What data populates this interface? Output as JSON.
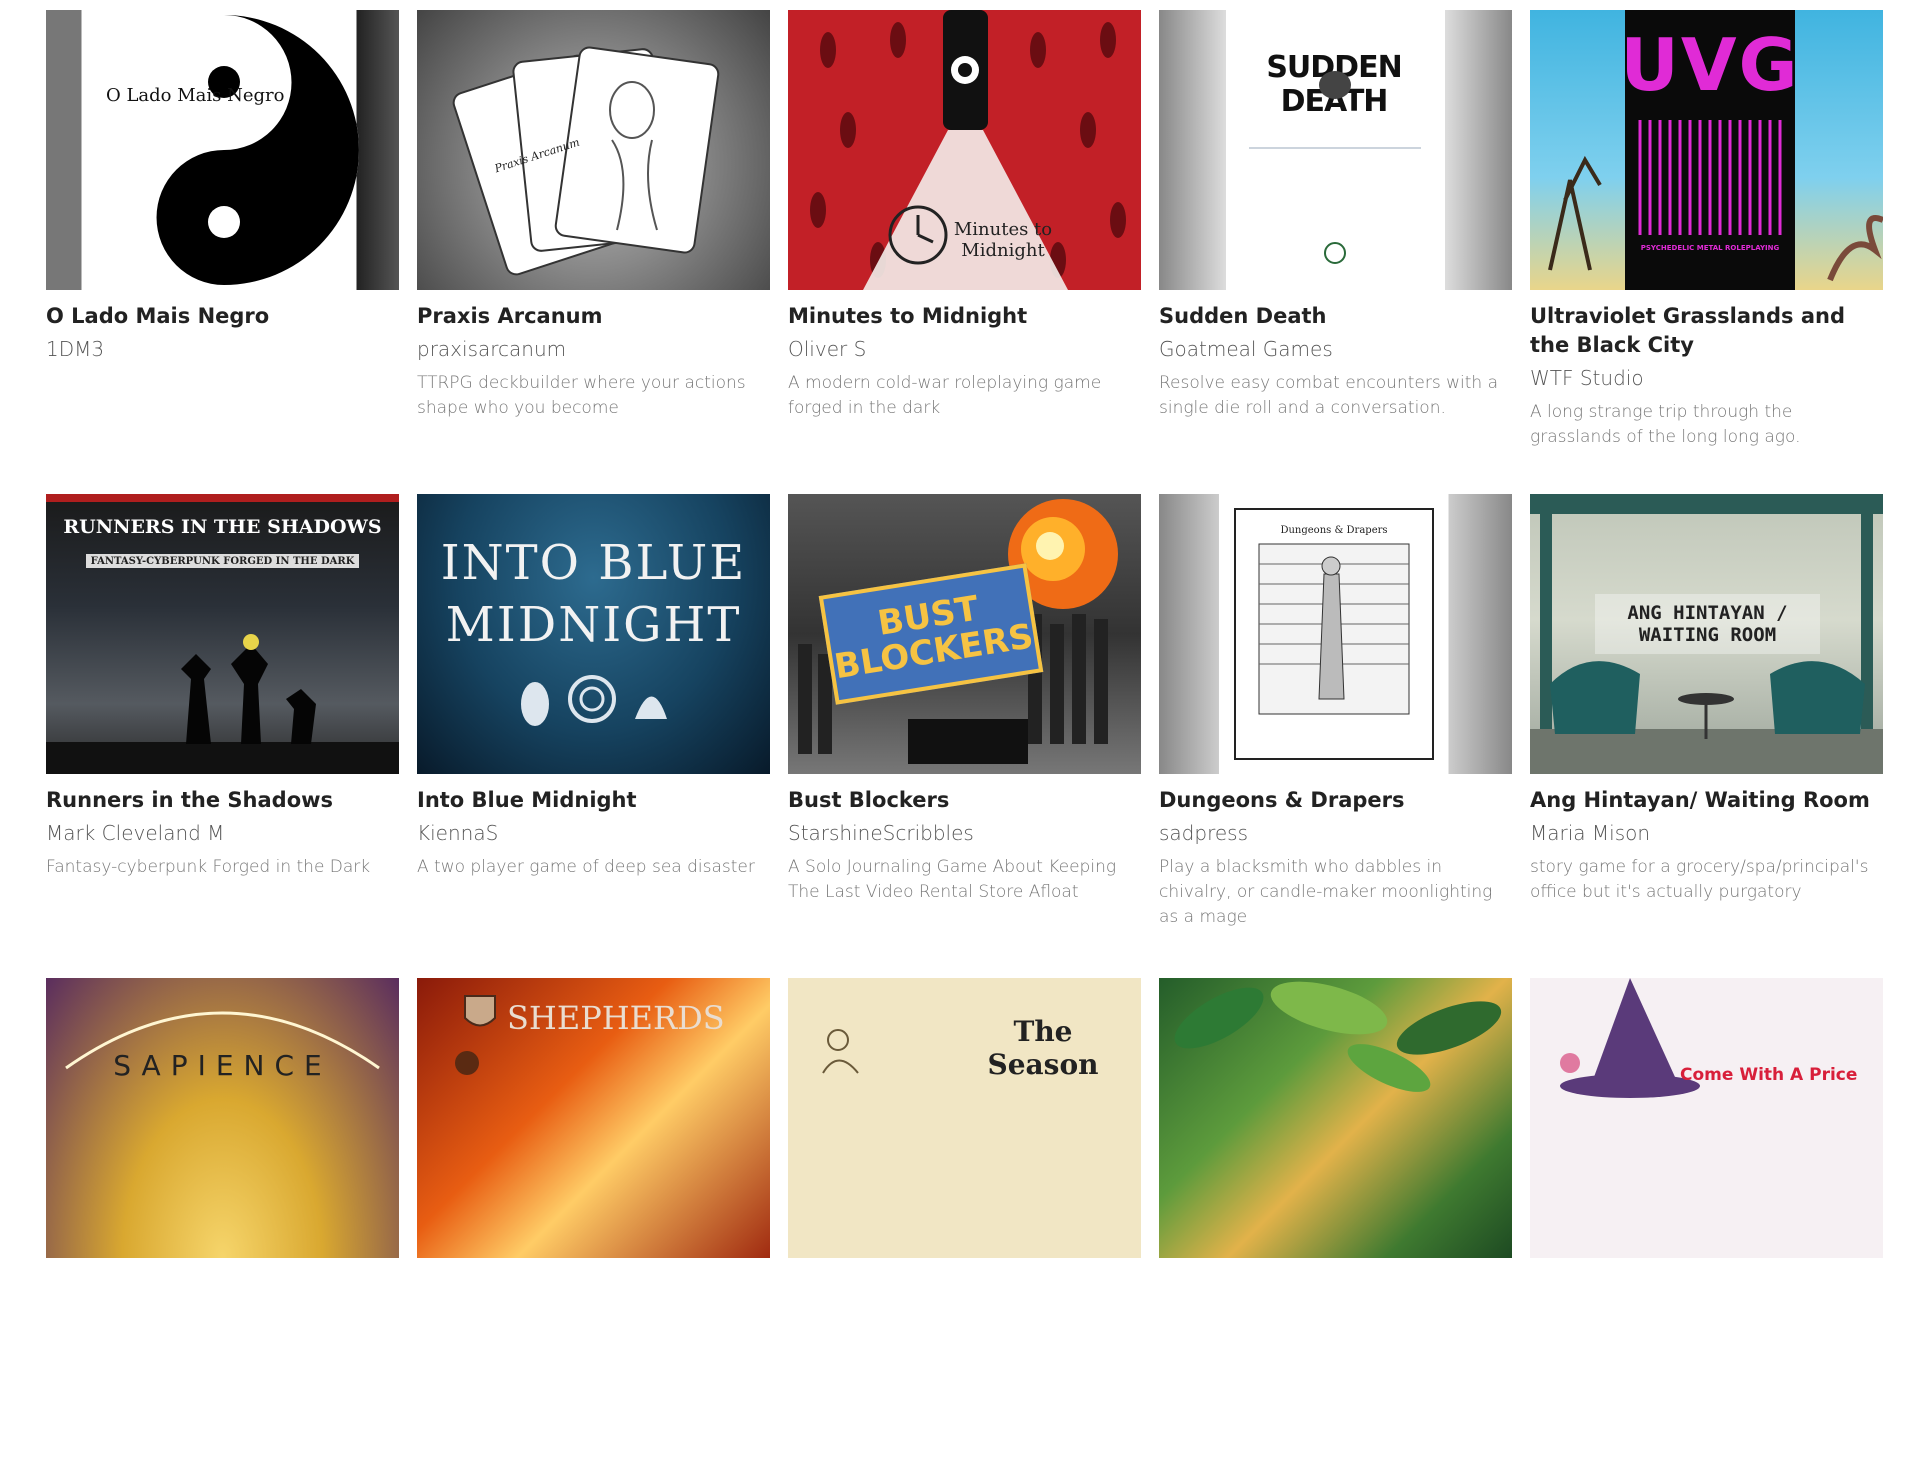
{
  "games": [
    [
      {
        "title": "O Lado Mais Negro",
        "author": "1DM3",
        "desc": "",
        "cover_text": "O Lado Mais Negro",
        "icon": "yin-yang"
      },
      {
        "title": "Praxis Arcanum",
        "author": "praxisarcanum",
        "desc": "TTRPG deckbuilder where your actions shape who you become",
        "cover_text": "Praxis Arcanum",
        "icon": "cards"
      },
      {
        "title": "Minutes to Midnight",
        "author": "Oliver S",
        "desc": "A modern cold-war roleplaying game forged in the dark",
        "cover_text": "Minutes to Midnight",
        "icon": "clock"
      },
      {
        "title": "Sudden Death",
        "author": "Goatmeal Games",
        "desc": "Resolve easy combat encounters with a single die roll and a conversation.",
        "cover_text": "SUDDEN DEATH",
        "icon": "skull"
      },
      {
        "title": "Ultraviolet Grasslands and the Black City",
        "author": "WTF Studio",
        "desc": "A long strange trip through the grasslands of the long long ago.",
        "cover_text": "UVG",
        "cover_subtext": "PSYCHEDELIC METAL ROLEPLAYING",
        "icon": "city"
      }
    ],
    [
      {
        "title": "Runners in the Shadows",
        "author": "Mark Cleveland M",
        "desc": "Fantasy-cyberpunk Forged in the Dark",
        "cover_text": "RUNNERS IN THE SHADOWS",
        "cover_subtext": "FANTASY-CYBERPUNK FORGED IN THE DARK",
        "icon": "silhouettes"
      },
      {
        "title": "Into Blue Midnight",
        "author": "KiennaS",
        "desc": "A two player game of deep sea disaster",
        "cover_text": "INTO BLUE MIDNIGHT",
        "icon": "shells"
      },
      {
        "title": "Bust Blockers",
        "author": "StarshineScribbles",
        "desc": "A Solo Journaling Game About Keeping The Last Video Rental Store Afloat",
        "cover_text": "BUST BLOCKERS",
        "icon": "fire"
      },
      {
        "title": "Dungeons & Drapers",
        "author": "sadpress",
        "desc": "Play a blacksmith who dabbles in chivalry, or candle-maker moonlighting as a mage",
        "cover_text": "Dungeons & Drapers",
        "icon": "engraving"
      },
      {
        "title": "Ang Hintayan/ Waiting Room",
        "author": "Maria Mison",
        "desc": "story game for a grocery/spa/principal's office but it's actually purgatory",
        "cover_text": "ANG HINTAYAN / WAITING ROOM",
        "icon": "chairs"
      }
    ],
    [
      {
        "title": "",
        "author": "",
        "desc": "",
        "cover_text": "SAPIENCE",
        "icon": "planet"
      },
      {
        "title": "",
        "author": "",
        "desc": "",
        "cover_text": "SHEPHERDS",
        "icon": "shield"
      },
      {
        "title": "",
        "author": "",
        "desc": "",
        "cover_text": "The Season",
        "icon": "lady"
      },
      {
        "title": "",
        "author": "",
        "desc": "",
        "cover_text": "",
        "icon": "leaves"
      },
      {
        "title": "",
        "author": "",
        "desc": "",
        "cover_text": "Come With A Price",
        "icon": "witch"
      }
    ]
  ],
  "colors": {
    "title": "#222222",
    "author": "#555555",
    "desc": "#777777",
    "accent": "#c22027"
  }
}
